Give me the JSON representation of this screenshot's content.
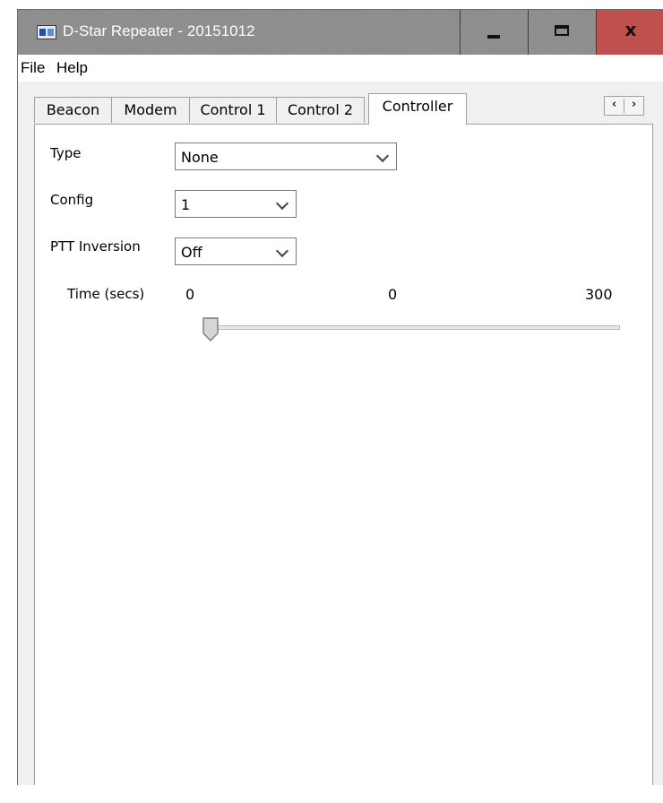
{
  "window": {
    "title": "D-Star Repeater - 20151012",
    "minimize_icon": "minimize-icon",
    "maximize_icon": "maximize-icon",
    "close_label": "x"
  },
  "menu": {
    "items": [
      "File",
      "Help"
    ]
  },
  "tabs": {
    "items": [
      "Beacon",
      "Modem",
      "Control 1",
      "Control 2",
      "Controller"
    ],
    "active": "Controller",
    "scroll_left": "‹",
    "scroll_right": "›"
  },
  "controller": {
    "type": {
      "label": "Type",
      "value": "None"
    },
    "config": {
      "label": "Config",
      "value": "1"
    },
    "ptt": {
      "label": "PTT Inversion",
      "value": "Off"
    },
    "time": {
      "label": "Time (secs)",
      "min": "0",
      "current": "0",
      "max": "300",
      "value_fraction": 0
    }
  },
  "colors": {
    "titlebar": "#8c8c8c",
    "close_button": "#c0504d",
    "window_bg": "#f0f0f0",
    "panel_bg": "#ffffff"
  }
}
